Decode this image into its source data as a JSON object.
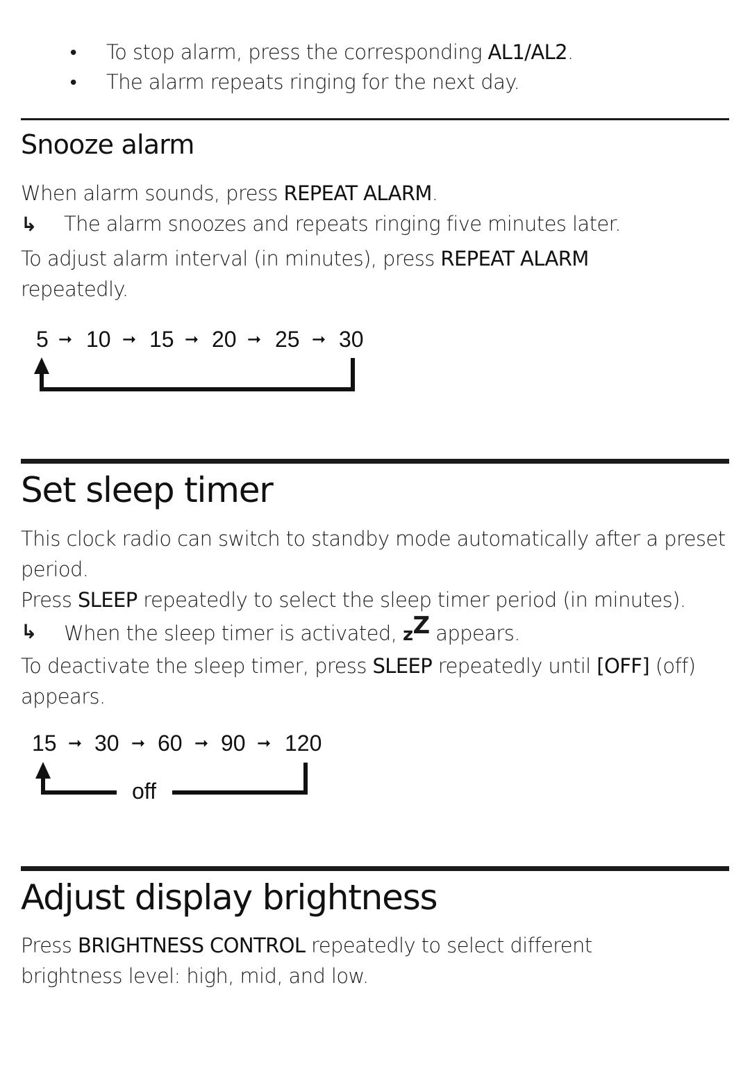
{
  "intro_bullets": [
    {
      "text": "To stop alarm, press the corresponding ",
      "bold": "AL1/AL2",
      "after": "."
    },
    {
      "text": "The alarm repeats ringing for the next day."
    }
  ],
  "snooze": {
    "heading": "Snooze alarm",
    "p1": {
      "text": "When alarm sounds, press ",
      "bold": "REPEAT ALARM",
      "after": "."
    },
    "result": "The alarm snoozes and repeats ringing five minutes later.",
    "p2_line1": {
      "text": "To adjust alarm interval (in minutes), press ",
      "bold": "REPEAT ALARM"
    },
    "p2_line2": "repeatedly.",
    "sequence": [
      "5",
      "10",
      "15",
      "20",
      "25",
      "30"
    ],
    "arrow_glyph": "➞"
  },
  "sleep": {
    "heading": "Set sleep timer",
    "p1_line1": "This clock radio can switch to standby mode automatically after a preset",
    "p1_line2": "period.",
    "p2": {
      "text": "Press ",
      "bold": "SLEEP",
      "after": " repeatedly to select the sleep timer period (in minutes)."
    },
    "result": {
      "text": "When the sleep timer is activated, ",
      "icon_small": "z",
      "icon_big": "Z",
      "after": " appears."
    },
    "p3_line1": {
      "text": "To deactivate the sleep timer, press ",
      "bold": "SLEEP",
      "mid": " repeatedly until ",
      "bold2": "[OFF]",
      "after": " (off)"
    },
    "p3_line2": "appears.",
    "sequence": [
      "15",
      "30",
      "60",
      "90",
      "120"
    ],
    "loop_label": "off"
  },
  "brightness": {
    "heading": "Adjust display brightness",
    "p1_line1": {
      "text": "Press ",
      "bold": "BRIGHTNESS CONTROL",
      "after": " repeatedly to select different"
    },
    "p1_line2": "brightness level: high, mid, and low."
  },
  "result_arrow": "↳"
}
